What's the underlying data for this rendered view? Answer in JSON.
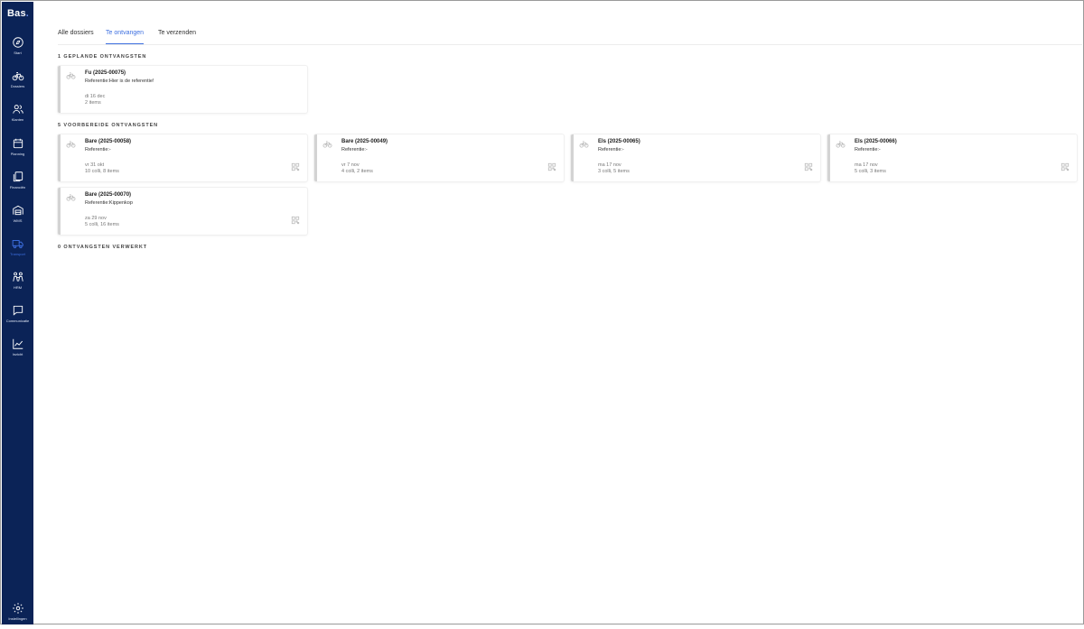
{
  "app": {
    "logo": "Bas",
    "logo_dot": "."
  },
  "nav": [
    {
      "label": "Start",
      "icon": "compass-icon"
    },
    {
      "label": "Dossiers",
      "icon": "bicycle-icon"
    },
    {
      "label": "Klanten",
      "icon": "users-icon"
    },
    {
      "label": "Planning",
      "icon": "calendar-icon"
    },
    {
      "label": "Financiën",
      "icon": "documents-icon"
    },
    {
      "label": "WMS",
      "icon": "warehouse-icon"
    },
    {
      "label": "Transport",
      "icon": "truck-icon",
      "active": true
    },
    {
      "label": "HRM",
      "icon": "people-icon"
    },
    {
      "label": "Communicatie",
      "icon": "chat-icon"
    },
    {
      "label": "Inzicht",
      "icon": "chart-icon"
    }
  ],
  "settings": {
    "label": "Instellingen",
    "icon": "gear-icon"
  },
  "tabs": [
    {
      "label": "Alle dossiers",
      "active": false
    },
    {
      "label": "Te ontvangen",
      "active": true
    },
    {
      "label": "Te verzenden",
      "active": false
    }
  ],
  "sections": {
    "planned": {
      "title": "1 GEPLANDE ONTVANGSTEN",
      "cards": [
        {
          "title": "Fu (2025-00075)",
          "ref": "Referentie:Hier is de referentie!",
          "date": "di 16 dec",
          "meta": "2 items",
          "qr": false
        }
      ]
    },
    "prepared": {
      "title": "5 VOORBEREIDE ONTVANGSTEN",
      "cards": [
        {
          "title": "Bare (2025-00058)",
          "ref": "Referentie:-",
          "date": "vr 31 okt",
          "meta": "10 colli, 8 items",
          "qr": true
        },
        {
          "title": "Bare (2025-00049)",
          "ref": "Referentie:-",
          "date": "vr 7 nov",
          "meta": "4 colli, 2 items",
          "qr": true
        },
        {
          "title": "Els (2025-00065)",
          "ref": "Referentie:-",
          "date": "ma 17 nov",
          "meta": "3 colli, 5 items",
          "qr": true
        },
        {
          "title": "Els (2025-00066)",
          "ref": "Referentie:-",
          "date": "ma 17 nov",
          "meta": "5 colli, 3 items",
          "qr": true
        },
        {
          "title": "Bare (2025-00070)",
          "ref": "Referentie:Kippenkop",
          "date": "za 29 nov",
          "meta": "5 colli, 16 items",
          "qr": true
        }
      ]
    },
    "processed": {
      "title": "0 ONTVANGSTEN VERWERKT"
    }
  },
  "colors": {
    "sidebar": "#0b2357",
    "accent": "#3d6fe0"
  }
}
